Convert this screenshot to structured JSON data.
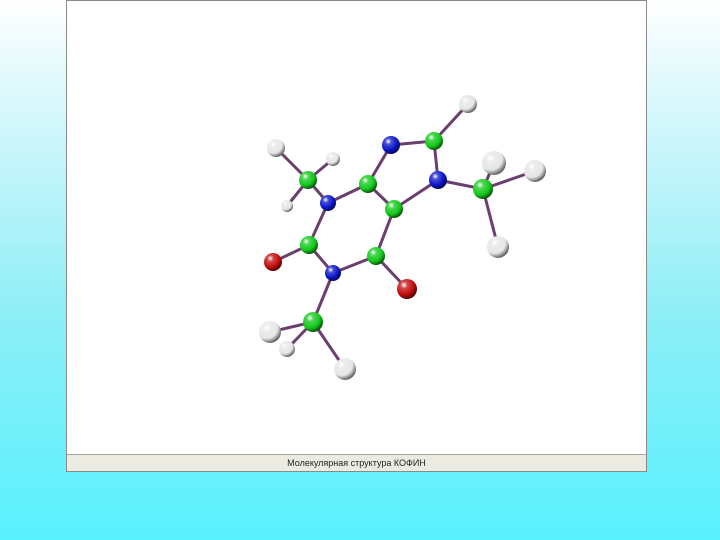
{
  "status": {
    "caption": "Молекулярная структура КОФИН"
  },
  "colors": {
    "carbon": "#12c81a",
    "nitrogen": "#0a14c8",
    "oxygen": "#c00c0c",
    "hydrogen": "#e6e6e6",
    "bond": "#6a3f6e"
  },
  "molecule": {
    "atoms": [
      {
        "id": "C2",
        "element": "carbon"
      },
      {
        "id": "N1",
        "element": "nitrogen"
      },
      {
        "id": "C6",
        "element": "carbon"
      },
      {
        "id": "O6",
        "element": "oxygen"
      },
      {
        "id": "C5",
        "element": "carbon"
      },
      {
        "id": "C4",
        "element": "carbon"
      },
      {
        "id": "N3",
        "element": "nitrogen"
      },
      {
        "id": "N9",
        "element": "nitrogen"
      },
      {
        "id": "C8",
        "element": "carbon"
      },
      {
        "id": "N7",
        "element": "nitrogen"
      },
      {
        "id": "O2",
        "element": "oxygen"
      },
      {
        "id": "C1m",
        "element": "carbon"
      },
      {
        "id": "C3m",
        "element": "carbon"
      },
      {
        "id": "C7m",
        "element": "carbon"
      },
      {
        "id": "H8",
        "element": "hydrogen"
      },
      {
        "id": "H3a",
        "element": "hydrogen"
      },
      {
        "id": "H3b",
        "element": "hydrogen"
      },
      {
        "id": "H3c",
        "element": "hydrogen"
      },
      {
        "id": "H7a",
        "element": "hydrogen"
      },
      {
        "id": "H7b",
        "element": "hydrogen"
      },
      {
        "id": "H7c",
        "element": "hydrogen"
      },
      {
        "id": "H1a",
        "element": "hydrogen"
      },
      {
        "id": "H1b",
        "element": "hydrogen"
      },
      {
        "id": "H1c",
        "element": "hydrogen"
      }
    ],
    "bonds": [
      [
        "C2",
        "N1"
      ],
      [
        "N1",
        "C6"
      ],
      [
        "C6",
        "C5"
      ],
      [
        "C5",
        "C4"
      ],
      [
        "C4",
        "N3"
      ],
      [
        "N3",
        "C2"
      ],
      [
        "C6",
        "O6"
      ],
      [
        "C5",
        "N7"
      ],
      [
        "N7",
        "C8"
      ],
      [
        "C8",
        "N9"
      ],
      [
        "N9",
        "C4"
      ],
      [
        "C2",
        "O2"
      ],
      [
        "N1",
        "C1m"
      ],
      [
        "N3",
        "C3m"
      ],
      [
        "N7",
        "C7m"
      ],
      [
        "C8",
        "H8"
      ],
      [
        "C3m",
        "H3a"
      ],
      [
        "C3m",
        "H3b"
      ],
      [
        "C3m",
        "H3c"
      ],
      [
        "C7m",
        "H7a"
      ],
      [
        "C7m",
        "H7b"
      ],
      [
        "C7m",
        "H7c"
      ],
      [
        "C1m",
        "H1a"
      ],
      [
        "C1m",
        "H1b"
      ],
      [
        "C1m",
        "H1c"
      ]
    ]
  }
}
